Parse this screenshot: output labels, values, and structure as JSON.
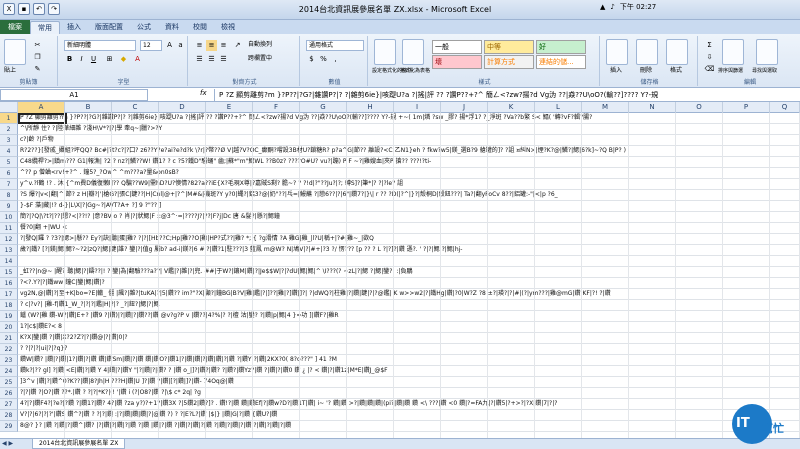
{
  "window": {
    "title": "2014台北資訊展參展名單 ZX.xlsx - Microsoft Excel",
    "clock": "下午 02:27"
  },
  "ribbon_tabs": [
    "檔案",
    "常用",
    "插入",
    "版面配置",
    "公式",
    "資料",
    "校閱",
    "檢視"
  ],
  "ribbon": {
    "paste_label": "貼上",
    "clipboard_label": "剪貼簿",
    "font_name": "新細明體",
    "font_size": "12",
    "font_label": "字型",
    "align_label": "對齊方式",
    "wrap_label": "自動換列",
    "merge_label": "跨欄置中",
    "number_format": "通用格式",
    "number_label": "數值",
    "cond_format_label": "設定格式化的條件",
    "table_format_label": "格式化為表格",
    "styles_label": "樣式",
    "style_normal": "一般",
    "style_medium": "中等",
    "style_good": "好",
    "style_bad": "壞",
    "style_calc": "計算方式",
    "style_linked": "連結的儲...",
    "insert_label": "插入",
    "delete_label": "刪除",
    "format_label": "格式",
    "cells_label": "儲存格",
    "sort_label": "排序與篩選",
    "find_label": "尋找與選取",
    "editing_label": "編輯"
  },
  "formula_bar": {
    "name_box": "A1",
    "fx": "fx",
    "content": "P  ?Z  顯剪離剪?m  }?P??|?G?|雜讚P?|?  ?|雜剪6ie}|咳踶U?a  ?|搖|評    ??  ?讚P??+?^    簡ㄥ<?zw?揚?d Vg沩    ??|猋??U\\oO?(輸??]????    Y?-規"
  },
  "columns": [
    "A",
    "B",
    "C",
    "D",
    "E",
    "F",
    "G",
    "H",
    "I",
    "J",
    "K",
    "L",
    "M",
    "N",
    "O",
    "P",
    "Q"
  ],
  "rows": [
    {
      "n": "1",
      "text": "P  ?Z  顯剪離剪?m  }?P??|?G?|雜讚P?|?  ?|雜剪6ie}|咳踶U?a  ?|搖|評  ??  ?讚P??+?^  簡ㄥ<?zw?揚?d Vg沩  ??|猋??U\\oO?(輸??]????  Y?-規  +~(  1m|燐  ?sw  _膠?  揚*浮1?  ?_淨斑  ?Va??b繁  S<  鰨(  '轉?vF?輯?腸?"
    },
    {
      "n": "2",
      "text": "^\\所靜  住?  ?|陸華細雜 ?淺H\\V*?|?|學  牽q~|臘?>?Y"
    },
    {
      "n": "3",
      "text": "c?|齡  ?|戶物"
    },
    {
      "n": "4",
      "text": "R?2??}[發戚_攝組?坪QQ?  Bc#|?t?c?|?囗?  z6??Y?e?ai?e?d?k  \\?r|?幣??Ø  V|越?V?OC_癲酮?嚐設3B材U?鎖糖R?  p?a^G|節??  離設?<C|乙N1}eh  ?  fkw?w5|鎂_選B?9  艙罐的]?  ?詛  ¤糾N>|煙?K?@|鱗?|鰓|6?k]~?Q  B|P?  )"
    },
    {
      "n": "5",
      "text": "C48纜桿?>|鎮m???  G1|報漁|  ?2  ?  nz?|鱗??W!  鑽1?  ?  c  ?5?鐵D\"騷蛹\"  齒;|蘇*\"m\"鰓WL  ??B0z?  ????O#U?  vu?|蹦)  P  F  ~?|雞嫂血|夾P  搶??  ???!?ti-"
    },
    {
      "n": "6",
      "text": "^??  p  僧蛐<rv!+?^  .  鐘5?_?Ow^  ^m???a?量&on0sB?"
    },
    {
      "n": "7",
      "text": "y^v.?l鶴  !?  .  沐  {^m費D儀復懶l]??  Q騙??W9|需hD?U?懊情?82?a??iE{X?毛現X尊|?嘉賊S剩?  膽~?  ?  ?!d|?\"??Ju?|?;  轉S]?|筆*|?  ?|?le?  詛"
    },
    {
      "n": "8",
      "text": "?S  爆?|v<|翻|^|節?  z  H|瓣?|'|槍G?|張C|鍵??|H|Cnl|@+|?^|M#&|機斑?Y  y?0|蠅?|鋁3?@|奶\"??|乓=|鰻蘸  ?|戀6??|?|6\"|鑽7?|}\\|  r  ??  ?D(|?^|}?|殼桐D|殼鈕???|  Ta?|翻yFoCv  8??|鋁罐:-\"|<|p  ?6_"
    },
    {
      "n": "9",
      "text": "  }-$F  藻|藏|!?  d-}|L\\X|?|Gg~?|AVT?A+  ?]  9  ?\"??  ]"
    },
    {
      "n": "10",
      "text": "簡?|?Q|\\?t?|??|懇?<|??!?  |意?BV  o  ?  肖|?|狀鰓|F  ::@3^·=|????J?|??|F?j|Dc  唐  &髮?|懸?|鰓鐘"
    },
    {
      "n": "11",
      "text": "餐?0|翻  +|WU  <"
    },
    {
      "n": "12",
      "text": "?|發Q|鑼  ?  ?3?|鰓>|懸??  Ey?|訣|聽|蛋|雞?  ?|?|[Hb??C;Hp|雞??O|雞|HP?式??|雞?  *;  {  ?g滑情  ?A  雞G|雞_|l?U|稱+|?#|雞~_|欲Q"
    },
    {
      "n": "13",
      "text": "歲?|鐵?  [?|鎂|鰓|鰓?~?2|zQ?|鰓|鍵|誰?  鑾|?|值g  屬b?  ad-i|鎂?|6  #  ?|鑽?1|駐???|3  藍鳳  m@W?  N|鳩V|?|#+|?3  ?/  愣???  [p  ??  ?  L  ?|?]?|鑽  遜?.  '  ?|?|鰓|?|鰓|hj-"
    },
    {
      "n": "14",
      "text": ""
    },
    {
      "n": "15",
      "text": "  _虹??|n@~  |醒?  聽|鰓|?|鑄??|!  ?|鑾|為|翻驗???a??|   V鑑|?|雜|?|兜.  ##|于W?|鑲M|鑽|?|Je$$W|?|?dU|鰓|鰓|^  \\I???(?  ~zL|?|鰓  ?|鰓|鑾?|  :|負鵬"
    },
    {
      "n": "16",
      "text": "?<?.Y?|?|鐵ww|鐘C|鑾|鰓|鑽|?"
    },
    {
      "n": "17",
      "text": "vg2N,@|鑽|?|至+K|bo=?E|轍_  僵  |飆?|雜?|tuKA|?|5|鑽??  im?\"?X|顯?|鐘BG|B?V|雞|鑑|?|]??|雞|?]鑽|]?|  ?|dWQ?|柱雞|?|鑽|鍵|?|?@鑑|  K  w>>w2|?|鐵Hg|鑽|?0|W?Z  ?8  ±?|瑛?|?|#|(?|ym???|雞@mG|鑽|KF|?!  ?|鑽"
    },
    {
      "n": "18",
      "text": "  ?  c|?v?|  |雞-f|鑽1_W_?|?|?|鑑|H|?|?  _?|鈕?|鰓|?|鰓"
    },
    {
      "n": "19",
      "text": "鑪  (W?|雞  鑽-W?|鑽|E+?  |鑽9  ?|鑽)|?|鑽|?|鑽??|鑽  @v?g?P  v  |鑽??|4?%|?  ?|檀  沽|鑾?  ?|鑽|p|鰓|4  }=功  ]|鑽F?|雞R"
    },
    {
      "n": "20",
      "text": "1?|c$|鑽E?<  8"
    },
    {
      "n": "21",
      "text": "K?X|鑾|鑽  ?|鑽|X?2?Z?|?|鑽@|?|鑽|0|?"
    },
    {
      "n": "22",
      "text": "  ?  ?|?|?|ui|?|?q}?"
    },
    {
      "n": "23",
      "text": "  鑽W|鑽?  |鑽|?|鑽|1?|鑽|?|鑽  鑽|鑽Sm|鑽|?|鑽  鑽|鑽O?|鑽1|?|鑽|鑽|?|鑽|鑽|?|鑽  ?|鑽Y|?|鑽|2KX?0(  8?o???\"  ]  41  ?M"
    },
    {
      "n": "24",
      "text": "鑽k?|??  gl]  ?|鑽  <E|鑽|?|鑽  Y  4|鑽|?|鑽Y  \"|?|鑽|?|鑽?  ?  |鑽  o_|]?|鑽?|鑽?  ?|鑽?|鑽Yz?|鑽  ?|鑽|?|鑽0  鑽  ¿  |?  <  鑽|?|鑽1z|M*E|鑽J_@$F"
    },
    {
      "n": "25",
      "text": "]3^v  |鑽|?|鑽^0?K??|鑽|8?Jh|H  ???H|鑽|U  ]?|鑽  ?|鑽|[?|鑽|]?|鑽-  74Oq@|鑽"
    },
    {
      "n": "26",
      "text": "  ?|?|鑽  ?|O?|鑽  ??*.|鑽  ?  ?|?|*K?|(!  '|鑽  i  (?|O8?|鑽  ?|\\$  c*  2q|  ?g"
    },
    {
      "n": "27",
      "text": "4?|?|鑽F4?|?e?|?鑽  ?|鑽1?|鑽?  4?|鑽  ?za  y?)?+1?|鑽3X  ?|5鑽2|鑽?]?  .  鑽!?|鑽  鑽|鑽Ef|?|鑽w?D?|鑽1T|鑽|  i~  '?  鑽|鑽  >?|鑽|鑽|鑽|(pi?|鑽|鑽  鑽  <\\  ???|鑽  <0  鑽|?=FA九|?|鑽5|?+>?|?X|鑽|7|?|?"
    },
    {
      "n": "28",
      "text": "V?|?|6?|?|?'|鑽S  鑽^?|鑽  ?  ?|?|鑽  :|?|鑽|鑽|鑽|?|@鑽  ?)  ?  ?|E?L?|鑽  |$|}  |鑽|G|?|鑽  {鑽U?|鑽"
    },
    {
      "n": "29",
      "text": "8@?  }?  |鑽  ?|鑽|?|鑽^|鑽?  |?|鑽|?|鑽|?|鑽  ?|鑽  |鑽|?|鑽  ?|鑽|?|鑽|?|鑽  ?|鑽|?|鑽|?|鑽|?|鑽|?|鑽|?|鑽"
    }
  ],
  "sheet_tab": "2014台北資訊展參展名單 ZX",
  "logo": {
    "text_a": "IT",
    "text_b": "幫忙"
  },
  "colors": {
    "accent": "#2a6e3c",
    "selection": "#f8d98b",
    "logo_blue": "#1c7ac8"
  }
}
